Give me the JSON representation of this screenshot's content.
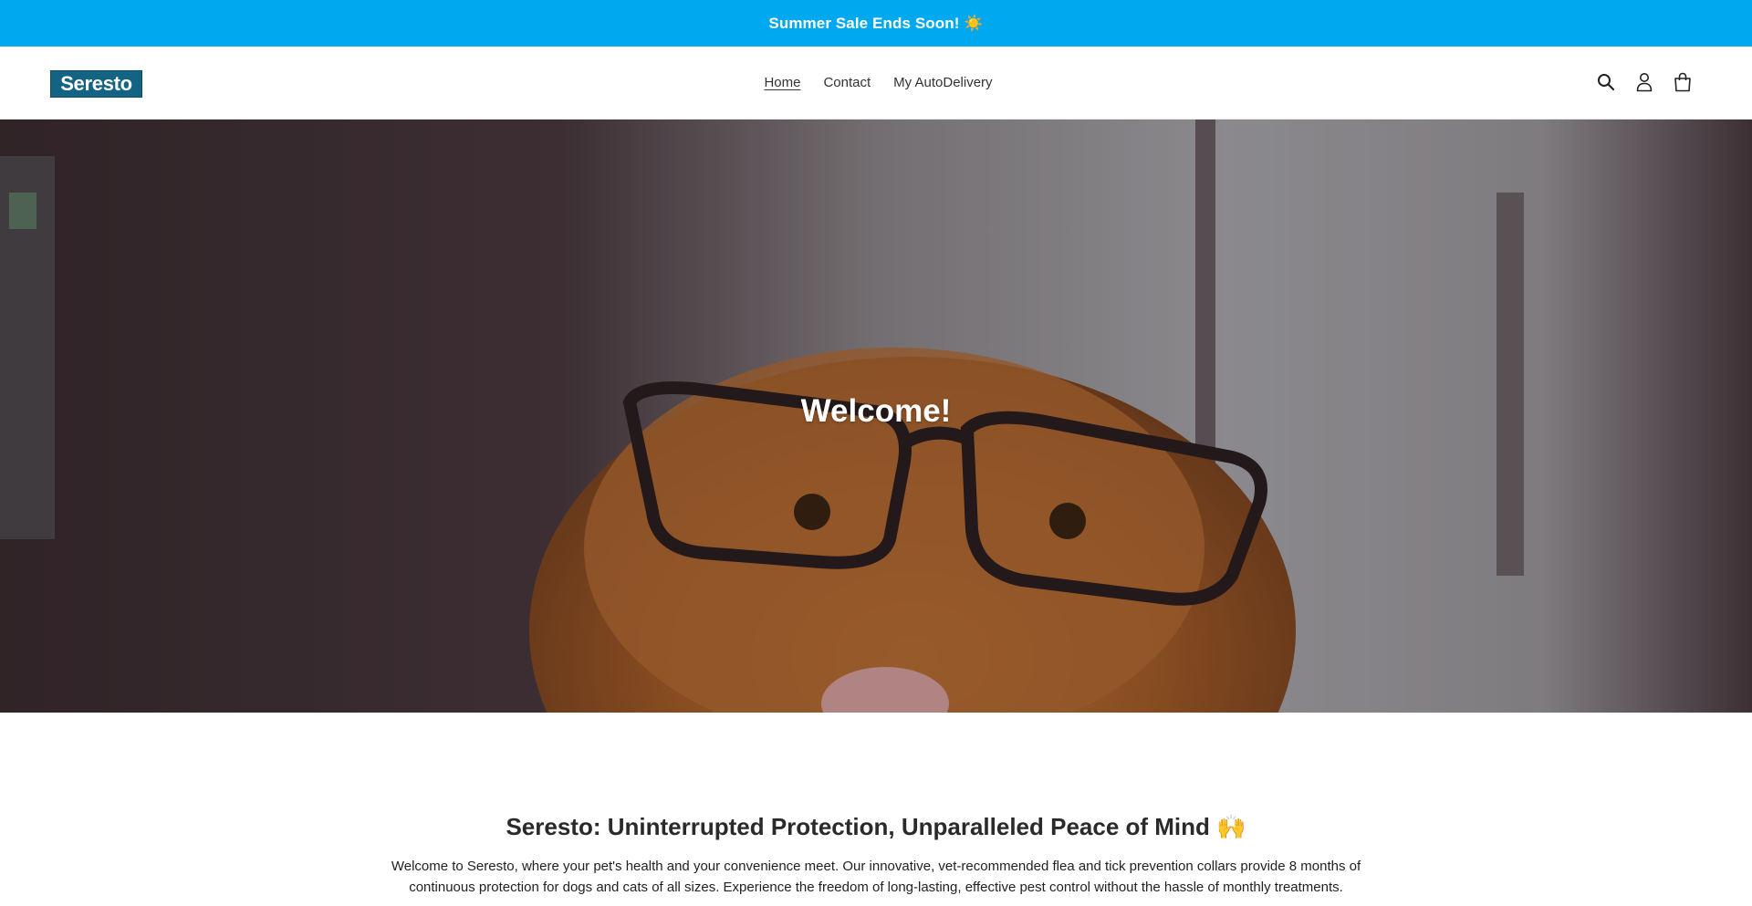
{
  "announcement": {
    "text": "Summer Sale Ends Soon! ☀️"
  },
  "header": {
    "logo_text": "Seresto",
    "nav": [
      {
        "label": "Home",
        "active": true
      },
      {
        "label": "Contact",
        "active": false
      },
      {
        "label": "My AutoDelivery",
        "active": false
      }
    ],
    "icons": [
      "search-icon",
      "account-icon",
      "cart-icon"
    ]
  },
  "hero": {
    "title": "Welcome!"
  },
  "intro": {
    "heading": "Seresto: Uninterrupted Protection, Unparalleled Peace of Mind 🙌",
    "body": "Welcome to Seresto, where your pet's health and your convenience meet. Our innovative, vet-recommended flea and tick prevention collars provide 8 months of continuous protection for dogs and cats of all sizes. Experience the freedom of long-lasting, effective pest control without the hassle of monthly treatments."
  },
  "colors": {
    "announcement_bg": "#00a8f0",
    "logo_bg": "#146383"
  }
}
